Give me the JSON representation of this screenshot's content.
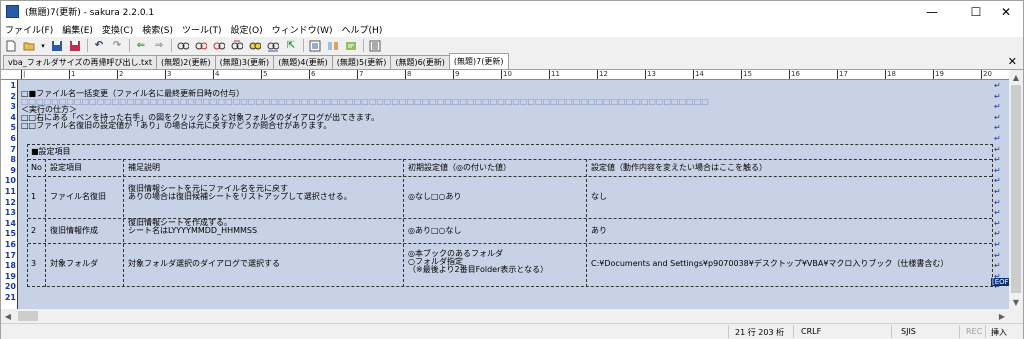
{
  "window": {
    "title": "(無題)7(更新) - sakura 2.2.0.1",
    "minimize": "—",
    "maximize": "☐",
    "close": "✕"
  },
  "menu": [
    "ファイル(F)",
    "編集(E)",
    "変換(C)",
    "検索(S)",
    "ツール(T)",
    "設定(O)",
    "ウィンドウ(W)",
    "ヘルプ(H)"
  ],
  "tabs": [
    "vba_フォルダサイズの再帰呼び出し.txt",
    "(無題)2(更新)",
    "(無題)3(更新)",
    "(無題)4(更新)",
    "(無題)5(更新)",
    "(無題)6(更新)",
    "(無題)7(更新)"
  ],
  "active_tab": 6,
  "tab_close": "✕",
  "ruler": [
    "|",
    "1",
    "2",
    "3",
    "4",
    "5",
    "6",
    "7",
    "8",
    "9",
    "10",
    "11",
    "12",
    "13",
    "14",
    "15",
    "16",
    "17",
    "18",
    "19",
    "20"
  ],
  "line_numbers": [
    "1",
    "2",
    "3",
    "4",
    "5",
    "6",
    "7",
    "8",
    "9",
    "10",
    "11",
    "12",
    "13",
    "14",
    "15",
    "16",
    "17",
    "18",
    "19",
    "20",
    "21"
  ],
  "lines": {
    "l1": "",
    "l2": "□■ファイル名一括変更（ファイル名に最終更新日時の付与）",
    "l3": "□□□□□□□□□□□□□□□□□□□□□□□□□□□□□□□□□□□□□□□□□□□□□□□□□□□□□□□□□□□□□□□□□□□□□□□□□□□□□□□□□□□□□□□□□□□",
    "l4": "＜実行の仕方＞",
    "l5": "□□右にある「ペンを持った右手」の図をクリックすると対象フォルダのダイアログが出てきます。",
    "l6": "□□ファイル名復旧の設定値が「あり」の場合は元に戻すかどうか問合せがあります。"
  },
  "eol_mark": "↵",
  "eof_mark": "[EOF]",
  "table": {
    "section_title": "■設定項目",
    "headers": [
      "No",
      "設定項目",
      "補足説明",
      "初期設定値（◎の付いた値）",
      "設定値（動作内容を変えたい場合はここを触る）"
    ],
    "rows": [
      {
        "no": "1",
        "item": "ファイル名復旧",
        "note": "復旧情報シートを元にファイル名を元に戻す\nありの場合は復旧候補シートをリストアップして選択させる。",
        "default": "◎なし□○あり",
        "value": "なし"
      },
      {
        "no": "2",
        "item": "復旧情報作成",
        "note": "復旧情報シートを作成する。\nシート名はLYYYYMMDD_HHMMSS",
        "default": "◎あり□○なし",
        "value": "あり"
      },
      {
        "no": "3",
        "item": "対象フォルダ",
        "note": "対象フォルダ選択のダイアログで選択する",
        "default": "◎本ブックのあるフォルダ\n○フォルダ指定\n（※最後より2番目Folder表示となる）",
        "value": "C:¥Documents and Settings¥p9070038¥デスクトップ¥VBA¥マクロ入りブック（仕様書含む）"
      }
    ]
  },
  "status": {
    "position": "21 行 203 桁",
    "newline": "CRLF",
    "encoding": "SJIS",
    "rec": "REC",
    "mode": "挿入"
  }
}
